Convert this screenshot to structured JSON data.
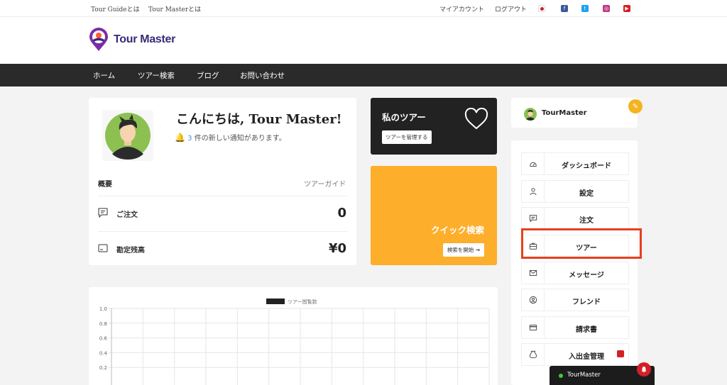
{
  "topbar": {
    "left_links": [
      "Tour Guideとは",
      "Tour Masterとは"
    ],
    "right_links": [
      "マイアカウント",
      "ログアウト"
    ],
    "social": [
      "japan-flag",
      "facebook",
      "twitter",
      "instagram",
      "youtube"
    ]
  },
  "brand": {
    "name": "Tour Master"
  },
  "nav": {
    "items": [
      "ホーム",
      "ツアー検索",
      "ブログ",
      "お問い合わせ"
    ]
  },
  "greeting": {
    "title": "こんにちは, Tour Master!",
    "notice_count": "3",
    "notice_text": " 件の新しい通知があります。"
  },
  "summary": {
    "heading": "概要",
    "role": "ツアーガイド",
    "rows": [
      {
        "label": "ご注文",
        "value": "0"
      },
      {
        "label": "勘定残高",
        "value": "¥0"
      }
    ]
  },
  "my_tour": {
    "title": "私のツアー",
    "button": "ツアーを管理する"
  },
  "quick_search": {
    "title": "クイック検索",
    "button": "検索を開始"
  },
  "chart_data": {
    "type": "line",
    "title": "",
    "legend": [
      "ツアー閲覧数"
    ],
    "xlabel": "",
    "ylabel": "",
    "ylim": [
      0,
      1
    ],
    "y_ticks": [
      "1.0",
      "0.8",
      "0.6",
      "0.4",
      "0.2"
    ],
    "grid": true,
    "series": [
      {
        "name": "ツアー閲覧数",
        "values": []
      }
    ]
  },
  "profile": {
    "name": "TourMaster"
  },
  "menu": {
    "items": [
      {
        "label": "ダッシュボード",
        "icon": "speedometer-icon"
      },
      {
        "label": "設定",
        "icon": "user-icon"
      },
      {
        "label": "注文",
        "icon": "message-icon"
      },
      {
        "label": "ツアー",
        "icon": "briefcase-icon"
      },
      {
        "label": "メッセージ",
        "icon": "envelope-icon"
      },
      {
        "label": "フレンド",
        "icon": "user-circle-icon"
      },
      {
        "label": "請求書",
        "icon": "credit-card-icon"
      },
      {
        "label": "入出金管理",
        "icon": "money-bag-icon"
      }
    ]
  },
  "chat": {
    "name": "TourMaster"
  },
  "colors": {
    "accent_orange": "#fdae2b",
    "dark": "#222222",
    "nav_bg": "#2a2a2a",
    "highlight": "#e8401c",
    "brand_purple": "#3a2a78"
  }
}
